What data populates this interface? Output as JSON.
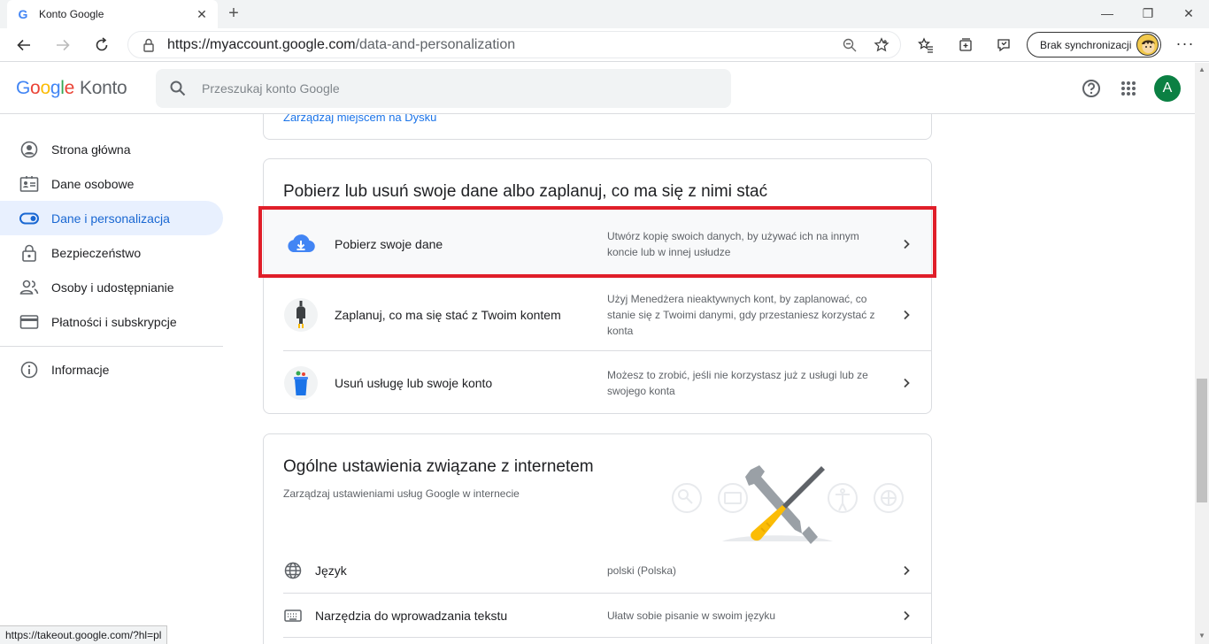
{
  "browser": {
    "tab": {
      "title": "Konto Google",
      "favicon": "G"
    },
    "window_controls": {
      "minimize": "—",
      "restore": "❐",
      "close": "✕"
    },
    "url": {
      "base": "https://myaccount.google.com",
      "path": "/data-and-personalization"
    },
    "sync_label": "Brak synchronizacji",
    "status_url": "https://takeout.google.com/?hl=pl"
  },
  "header": {
    "logo": {
      "letters": [
        "G",
        "o",
        "o",
        "g",
        "l",
        "e"
      ],
      "suffix": "Konto"
    },
    "search_placeholder": "Przeszukaj konto Google",
    "avatar_letter": "A"
  },
  "sidebar": {
    "items": [
      {
        "label": "Strona główna",
        "icon": "account-circle-icon"
      },
      {
        "label": "Dane osobowe",
        "icon": "id-card-icon"
      },
      {
        "label": "Dane i personalizacja",
        "icon": "toggle-icon",
        "active": true
      },
      {
        "label": "Bezpieczeństwo",
        "icon": "lock-icon"
      },
      {
        "label": "Osoby i udostępnianie",
        "icon": "people-icon"
      },
      {
        "label": "Płatności i subskrypcje",
        "icon": "credit-card-icon"
      }
    ],
    "info_label": "Informacje"
  },
  "storage_card": {
    "link": "Zarządzaj miejscem na Dysku"
  },
  "download_card": {
    "title": "Pobierz lub usuń swoje dane albo zaplanuj, co ma się z nimi stać",
    "rows": [
      {
        "label": "Pobierz swoje dane",
        "desc": "Utwórz kopię swoich danych, by używać ich na innym koncie lub w innej usłudze",
        "icon": "cloud-download-icon"
      },
      {
        "label": "Zaplanuj, co ma się stać z Twoim kontem",
        "desc": "Użyj Menedżera nieaktywnych kont, by zaplanować, co stanie się z Twoimi danymi, gdy przestaniesz korzystać z konta",
        "icon": "plug-icon"
      },
      {
        "label": "Usuń usługę lub swoje konto",
        "desc": "Możesz to zrobić, jeśli nie korzystasz już z usługi lub ze swojego konta",
        "icon": "trash-bin-icon"
      }
    ]
  },
  "web_card": {
    "title": "Ogólne ustawienia związane z internetem",
    "subtitle": "Zarządzaj ustawieniami usług Google w internecie",
    "rows": [
      {
        "label": "Język",
        "desc": "polski (Polska)",
        "icon": "globe-icon"
      },
      {
        "label": "Narzędzia do wprowadzania tekstu",
        "desc": "Ułatw sobie pisanie w swoim języku",
        "icon": "keyboard-icon"
      }
    ]
  },
  "colors": {
    "accent": "#1a73e8",
    "active_nav_bg": "#e8f0fe",
    "highlight": "#e01e29",
    "avatar": "#0b8043"
  }
}
